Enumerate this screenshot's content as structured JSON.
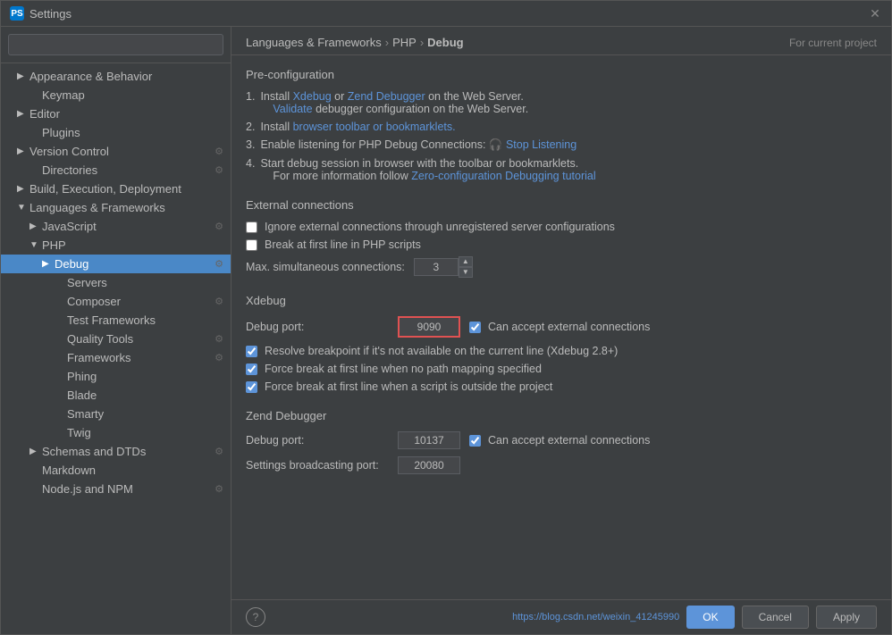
{
  "window": {
    "title": "Settings",
    "app_icon": "PS"
  },
  "search": {
    "placeholder": ""
  },
  "sidebar": {
    "items": [
      {
        "id": "appearance-behavior",
        "label": "Appearance & Behavior",
        "indent": 1,
        "arrow": "▶",
        "selected": false,
        "has_icon": false
      },
      {
        "id": "keymap",
        "label": "Keymap",
        "indent": 2,
        "arrow": "",
        "selected": false,
        "has_icon": false
      },
      {
        "id": "editor",
        "label": "Editor",
        "indent": 1,
        "arrow": "▶",
        "selected": false,
        "has_icon": false
      },
      {
        "id": "plugins",
        "label": "Plugins",
        "indent": 2,
        "arrow": "",
        "selected": false,
        "has_icon": false
      },
      {
        "id": "version-control",
        "label": "Version Control",
        "indent": 1,
        "arrow": "▶",
        "selected": false,
        "has_icon": true
      },
      {
        "id": "directories",
        "label": "Directories",
        "indent": 2,
        "arrow": "",
        "selected": false,
        "has_icon": true
      },
      {
        "id": "build-execution-deployment",
        "label": "Build, Execution, Deployment",
        "indent": 1,
        "arrow": "▶",
        "selected": false,
        "has_icon": false
      },
      {
        "id": "languages-frameworks",
        "label": "Languages & Frameworks",
        "indent": 1,
        "arrow": "▼",
        "selected": false,
        "has_icon": false
      },
      {
        "id": "javascript",
        "label": "JavaScript",
        "indent": 2,
        "arrow": "▶",
        "selected": false,
        "has_icon": true
      },
      {
        "id": "php",
        "label": "PHP",
        "indent": 2,
        "arrow": "▼",
        "selected": false,
        "has_icon": false
      },
      {
        "id": "debug",
        "label": "Debug",
        "indent": 3,
        "arrow": "▶",
        "selected": true,
        "has_icon": true
      },
      {
        "id": "servers",
        "label": "Servers",
        "indent": 4,
        "arrow": "",
        "selected": false,
        "has_icon": false
      },
      {
        "id": "composer",
        "label": "Composer",
        "indent": 4,
        "arrow": "",
        "selected": false,
        "has_icon": true
      },
      {
        "id": "test-frameworks",
        "label": "Test Frameworks",
        "indent": 4,
        "arrow": "",
        "selected": false,
        "has_icon": false
      },
      {
        "id": "quality-tools",
        "label": "Quality Tools",
        "indent": 4,
        "arrow": "",
        "selected": false,
        "has_icon": true
      },
      {
        "id": "frameworks",
        "label": "Frameworks",
        "indent": 4,
        "arrow": "",
        "selected": false,
        "has_icon": true
      },
      {
        "id": "phing",
        "label": "Phing",
        "indent": 4,
        "arrow": "",
        "selected": false,
        "has_icon": false
      },
      {
        "id": "blade",
        "label": "Blade",
        "indent": 4,
        "arrow": "",
        "selected": false,
        "has_icon": false
      },
      {
        "id": "smarty",
        "label": "Smarty",
        "indent": 4,
        "arrow": "",
        "selected": false,
        "has_icon": false
      },
      {
        "id": "twig",
        "label": "Twig",
        "indent": 4,
        "arrow": "",
        "selected": false,
        "has_icon": false
      },
      {
        "id": "schemas-dtds",
        "label": "Schemas and DTDs",
        "indent": 2,
        "arrow": "▶",
        "selected": false,
        "has_icon": true
      },
      {
        "id": "markdown",
        "label": "Markdown",
        "indent": 2,
        "arrow": "",
        "selected": false,
        "has_icon": false
      },
      {
        "id": "nodejs-npm",
        "label": "Node.js and NPM",
        "indent": 2,
        "arrow": "",
        "selected": false,
        "has_icon": true
      }
    ]
  },
  "breadcrumb": {
    "parts": [
      "Languages & Frameworks",
      "PHP",
      "Debug"
    ]
  },
  "for_project": "For current project",
  "panel": {
    "preconfiguration_title": "Pre-configuration",
    "steps": [
      {
        "num": "1.",
        "text_before": "Install",
        "link1": "Xdebug",
        "text_mid1": "or",
        "link2": "Zend Debugger",
        "text_after": "on the Web Server.",
        "sub_link": "Validate",
        "sub_text": "debugger configuration on the Web Server."
      },
      {
        "num": "2.",
        "text_before": "Install",
        "link1": "browser toolbar or bookmarklets."
      },
      {
        "num": "3.",
        "text_before": "Enable listening for PHP Debug Connections:",
        "link1": "Stop Listening",
        "icon": "🎧"
      },
      {
        "num": "4.",
        "text_before": "Start debug session in browser with the toolbar or bookmarklets.",
        "sub_text": "For more information follow",
        "sub_link": "Zero-configuration Debugging tutorial"
      }
    ],
    "external_connections": {
      "title": "External connections",
      "checkboxes": [
        {
          "id": "ignore-ext",
          "label": "Ignore external connections through unregistered server configurations",
          "checked": false
        },
        {
          "id": "break-first-line",
          "label": "Break at first line in PHP scripts",
          "checked": false
        }
      ],
      "max_connections_label": "Max. simultaneous connections:",
      "max_connections_value": "3"
    },
    "xdebug": {
      "title": "Xdebug",
      "debug_port_label": "Debug port:",
      "debug_port_value": "9090",
      "can_accept_label": "Can accept external connections",
      "can_accept_checked": true,
      "checkboxes": [
        {
          "id": "resolve-breakpoint",
          "label": "Resolve breakpoint if it's not available on the current line (Xdebug 2.8+)",
          "checked": true
        },
        {
          "id": "force-break-no-path",
          "label": "Force break at first line when no path mapping specified",
          "checked": true
        },
        {
          "id": "force-break-outside",
          "label": "Force break at first line when a script is outside the project",
          "checked": true
        }
      ]
    },
    "zend_debugger": {
      "title": "Zend Debugger",
      "debug_port_label": "Debug port:",
      "debug_port_value": "10137",
      "can_accept_label": "Can accept external connections",
      "can_accept_checked": true,
      "settings_broadcast_label": "Settings broadcasting port:",
      "settings_broadcast_value": "20080"
    }
  },
  "footer": {
    "url": "https://blog.csdn.net/weixin_41245990",
    "ok_label": "OK",
    "cancel_label": "Cancel",
    "apply_label": "Apply"
  },
  "help": "?"
}
